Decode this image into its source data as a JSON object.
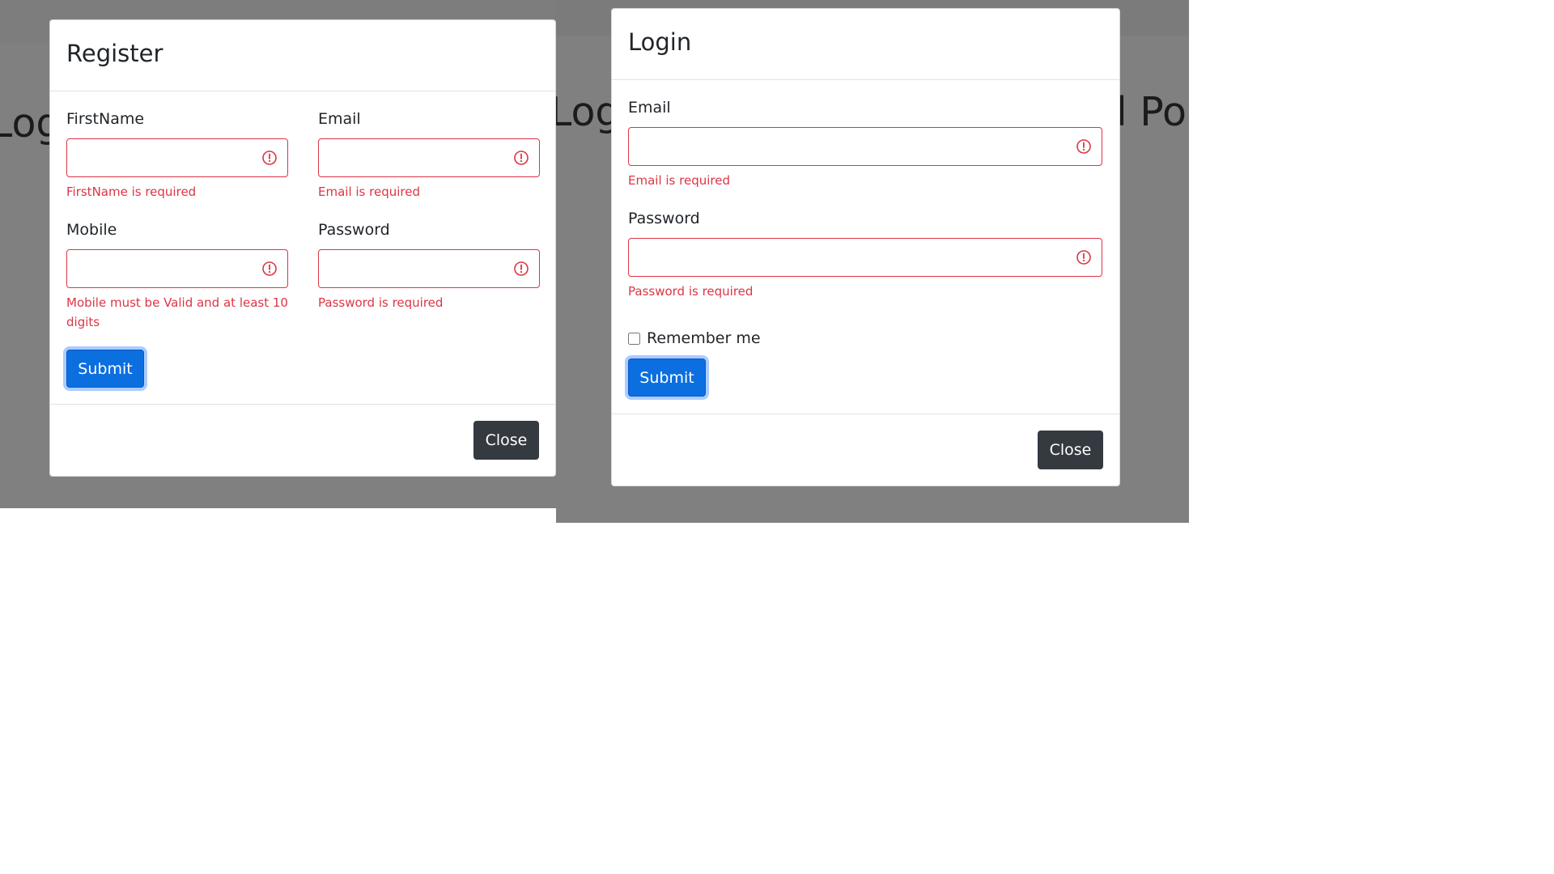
{
  "background": {
    "left_heading_fragment": "Log",
    "right_heading_fragment_left": "Log",
    "right_heading_fragment_right": "l Po"
  },
  "register": {
    "title": "Register",
    "fields": {
      "firstname": {
        "label": "FirstName",
        "value": "",
        "error": "FirstName is required"
      },
      "email": {
        "label": "Email",
        "value": "",
        "error": "Email is required"
      },
      "mobile": {
        "label": "Mobile",
        "value": "",
        "error": "Mobile must be Valid and at least 10 digits"
      },
      "password": {
        "label": "Password",
        "value": "",
        "error": "Password is required"
      }
    },
    "submit_label": "Submit",
    "close_label": "Close"
  },
  "login": {
    "title": "Login",
    "fields": {
      "email": {
        "label": "Email",
        "value": "",
        "error": "Email is required"
      },
      "password": {
        "label": "Password",
        "value": "",
        "error": "Password is required"
      }
    },
    "remember_label": "Remember me",
    "remember_checked": false,
    "submit_label": "Submit",
    "close_label": "Close"
  },
  "colors": {
    "overlay": "#808080",
    "error": "#dc3545",
    "primary": "#0b6fe0",
    "dark_button": "#343a40"
  },
  "icons": {
    "invalid": "exclamation-circle-icon"
  }
}
